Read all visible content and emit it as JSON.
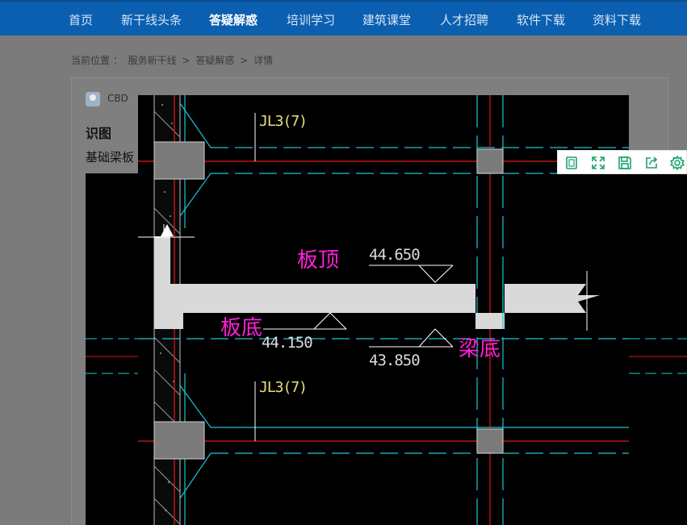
{
  "nav": {
    "items": [
      {
        "label": "首页",
        "active": false
      },
      {
        "label": "新干线头条",
        "active": false
      },
      {
        "label": "答疑解惑",
        "active": true
      },
      {
        "label": "培训学习",
        "active": false
      },
      {
        "label": "建筑课堂",
        "active": false
      },
      {
        "label": "人才招聘",
        "active": false
      },
      {
        "label": "软件下载",
        "active": false
      },
      {
        "label": "资料下载",
        "active": false
      }
    ]
  },
  "breadcrumb": {
    "prefix": "当前位置 ：",
    "items": [
      "服务新干线",
      "答疑解惑",
      "详情"
    ],
    "separator": ">"
  },
  "post": {
    "username": "CBD",
    "title": "识图",
    "body": "基础梁板"
  },
  "toolbar": {
    "icons": [
      "original-size-icon",
      "fullscreen-icon",
      "save-icon",
      "share-icon",
      "settings-icon"
    ]
  },
  "drawing": {
    "beam_label_top": "JL3(7)",
    "beam_label_bottom": "JL3(7)",
    "label_slab_top": "板顶",
    "label_slab_bottom": "板底",
    "label_beam_bottom": "梁底",
    "elev_slab_top": "44.650",
    "elev_slab_bottom": "44.150",
    "elev_beam_bottom": "43.850"
  },
  "colors": {
    "nav_bg": "#0b5fb0",
    "overlay_bg": "#7b7b7b",
    "cad_bg": "#000000",
    "cad_cyan": "#18c7d6",
    "cad_red": "#e01818",
    "cad_label": "#ff1fd6",
    "toolbar_icon": "#1aa36a"
  }
}
